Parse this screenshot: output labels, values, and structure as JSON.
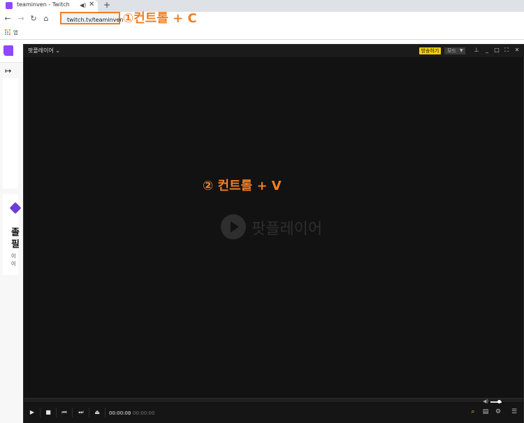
{
  "browser": {
    "tab_title": "teaminven - Twitch",
    "tab_audio_icon": "speaker-icon",
    "tab_close": "✕",
    "new_tab": "+",
    "url": "twitch.tv/teaminven",
    "bookmarks_label": "앱"
  },
  "annotations": {
    "step1": "①컨트롤 + C",
    "step2": "② 컨트롤 + V",
    "accent_color": "#f07f26"
  },
  "twitch": {
    "brand_color": "#9146ff",
    "sidebar_expand": "↦",
    "promo_line1": "졸",
    "promo_line2": "필",
    "promo_line3": "이",
    "promo_line4": "이"
  },
  "player": {
    "name": "팟플레이어",
    "broadcast_label": "방송하기",
    "mode_label": "모드",
    "logo_text": "팟플레이어",
    "time_current": "00:00:00",
    "time_separator": "/",
    "time_total": "00:00:00",
    "volume_level": 0.75,
    "broadcast_color": "#f5d000"
  }
}
